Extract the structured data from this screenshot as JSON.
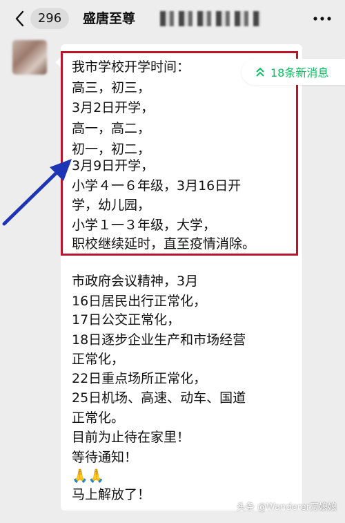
{
  "header": {
    "back_icon": "chevron-left-icon",
    "unread_count": "296",
    "title": "盛唐至尊",
    "more_icon": "ellipsis-icon"
  },
  "new_messages": {
    "label": "18条新消息",
    "icon": "double-chevron-up-icon",
    "color": "#07c160"
  },
  "message": {
    "highlight_color": "#b5162b",
    "lines": [
      "我市学校开学时间：",
      "高三，初三，",
      "3月2日开学，",
      "高一，高二，",
      "初一，初二，",
      "3月9日开学，",
      "小学４一６年级，3月16日开",
      "学，幼儿园，",
      "小学１一３年级，大学，",
      "职校继续延时，直至疫情消除。",
      "市政府会议精神，3月",
      "16日居民出行正常化，",
      "17日公交正常化，",
      "18日逐步企业生产和市场经营",
      "正常化，",
      "22日重点场所正常化，",
      "25日机场、高速、动车、国道",
      "正常化。",
      "目前为止待在家里！",
      "等待通知！",
      "🙏🙏",
      "马上解放了！"
    ]
  },
  "watermark": {
    "text": "头条 @Wanderer万娘娘"
  }
}
